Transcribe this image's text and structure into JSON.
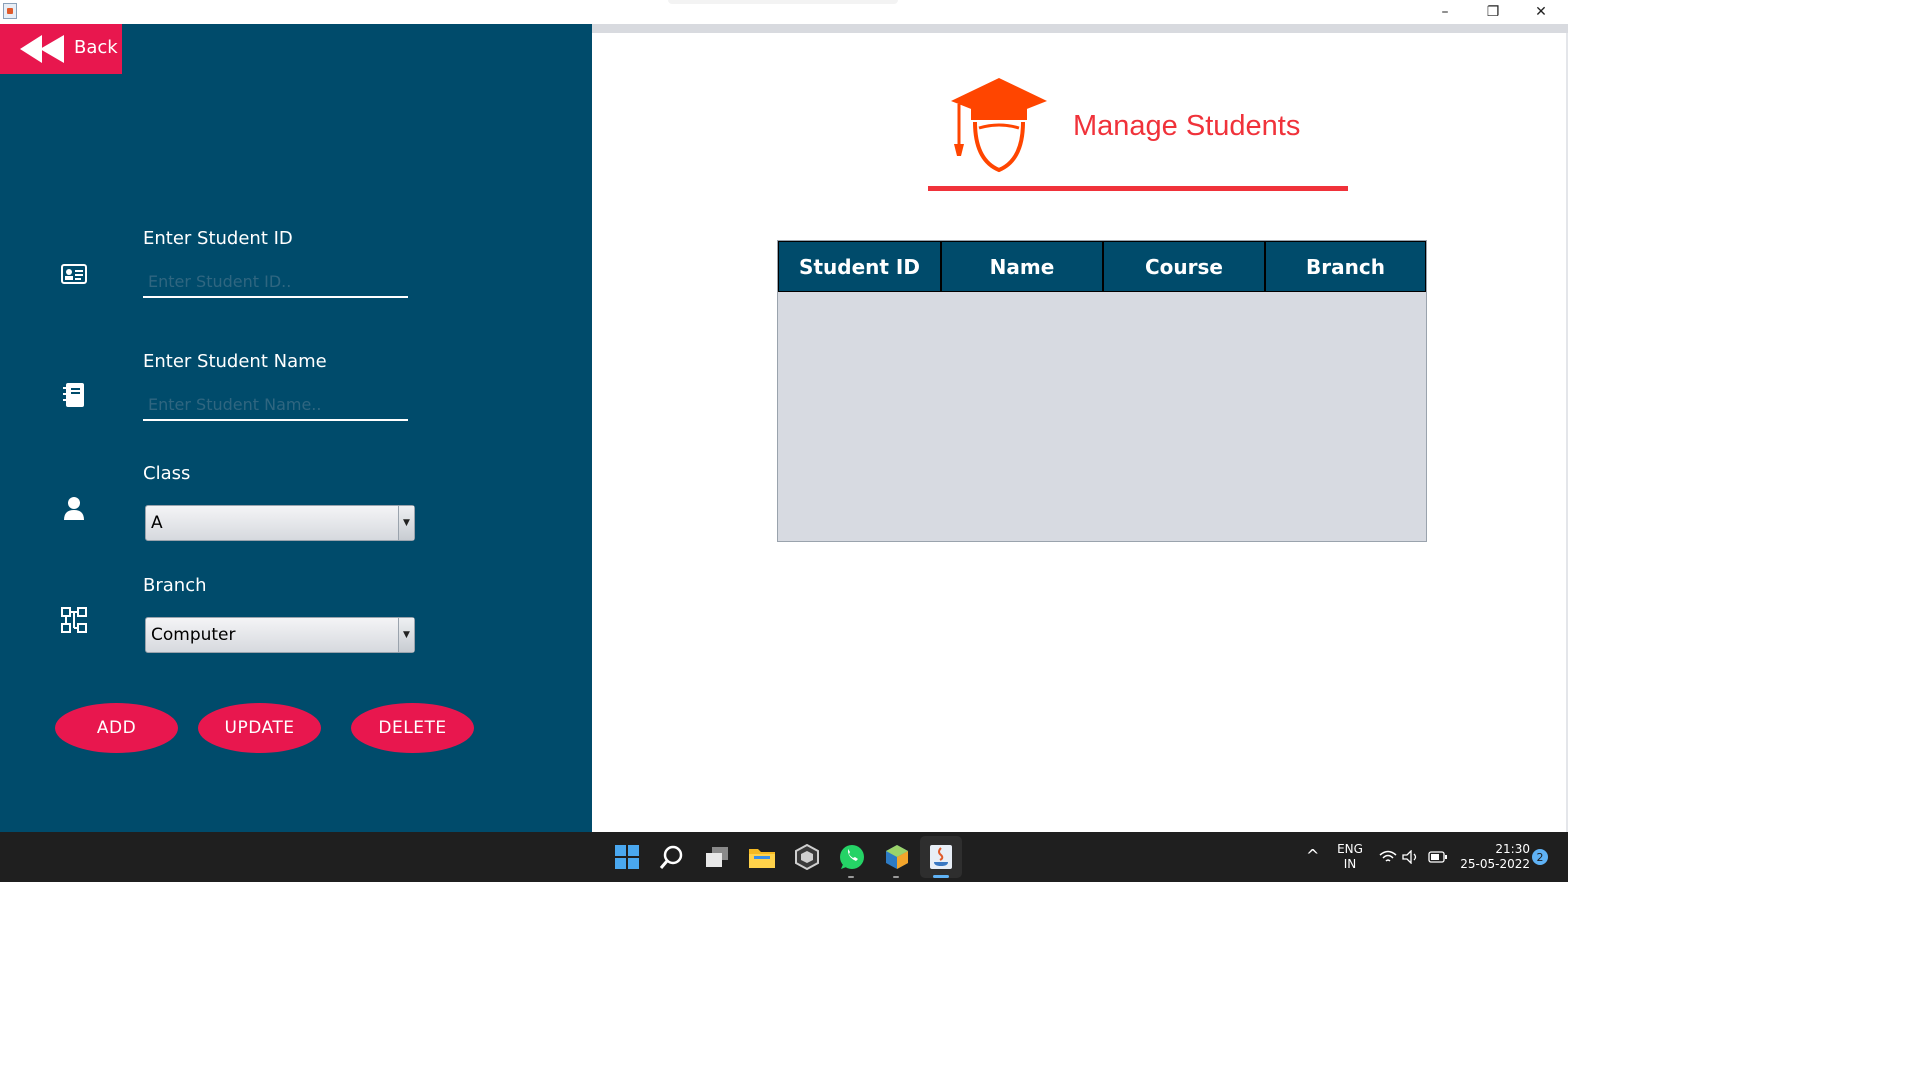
{
  "window": {
    "minimize_label": "–",
    "restore_label": "❐",
    "close_label": "✕"
  },
  "sidebar": {
    "back_label": "Back",
    "student_id": {
      "label": "Enter Student ID",
      "placeholder": "Enter Student ID..",
      "value": ""
    },
    "student_name": {
      "label": "Enter Student Name",
      "placeholder": "Enter Student Name..",
      "value": ""
    },
    "class": {
      "label": "Class",
      "selected": "A"
    },
    "branch": {
      "label": "Branch",
      "selected": "Computer"
    },
    "buttons": {
      "add": "ADD",
      "update": "UPDATE",
      "delete": "DELETE"
    }
  },
  "main": {
    "title": "Manage Students",
    "table": {
      "columns": [
        "Student ID",
        "Name",
        "Course",
        "Branch"
      ],
      "rows": []
    }
  },
  "taskbar": {
    "apps": [
      "start-icon",
      "search-icon",
      "task-view-icon",
      "file-explorer-icon",
      "unity-icon",
      "whatsapp-icon",
      "netbeans-icon",
      "java-icon"
    ],
    "language": {
      "line1": "ENG",
      "line2": "IN"
    },
    "clock": {
      "time": "21:30",
      "date": "25-05-2022"
    },
    "notifications": "2"
  },
  "colors": {
    "sidebar_bg": "#004b6b",
    "accent_red": "#e8174e",
    "title_red": "#f0323a",
    "icon_orange": "#ff4500",
    "table_header": "#004b6b",
    "table_body": "#d7dae1"
  }
}
